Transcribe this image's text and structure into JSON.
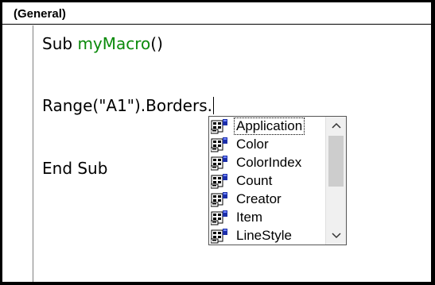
{
  "procedure_combo": {
    "value": "(General)"
  },
  "code": {
    "line1": {
      "keyword": "Sub ",
      "name": "myMacro",
      "parens": "()"
    },
    "line2": "Range(\"A1\").Borders.",
    "line3": "End Sub"
  },
  "autocomplete": {
    "items": [
      {
        "label": "Application",
        "icon": "property-icon"
      },
      {
        "label": "Color",
        "icon": "property-icon"
      },
      {
        "label": "ColorIndex",
        "icon": "property-icon"
      },
      {
        "label": "Count",
        "icon": "property-icon"
      },
      {
        "label": "Creator",
        "icon": "property-icon"
      },
      {
        "label": "Item",
        "icon": "property-icon"
      },
      {
        "label": "LineStyle",
        "icon": "property-icon"
      }
    ],
    "selected_index": 0,
    "scroll": {
      "up_glyph": "︿",
      "down_glyph": "﹀"
    }
  },
  "colors": {
    "identifier": "#0a8a0a",
    "background": "#000000"
  }
}
